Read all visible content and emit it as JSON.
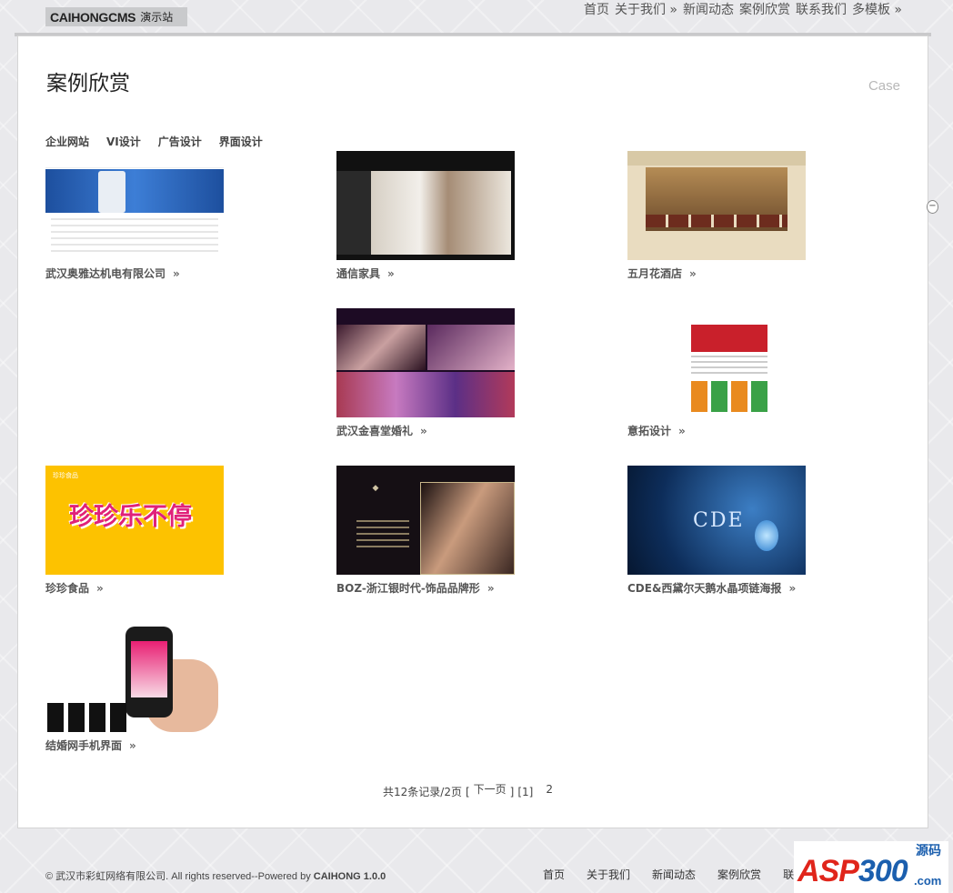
{
  "header": {
    "logo_brand": "CAIHONGCMS",
    "logo_sub": "演示站",
    "nav": [
      "首页",
      "关于我们 »",
      "新闻动态",
      "案例欣赏",
      "联系我们",
      "多模板 »"
    ]
  },
  "page": {
    "title": "案例欣赏",
    "title_en": "Case",
    "categories": [
      "企业网站",
      "VI设计",
      "广告设计",
      "界面设计"
    ]
  },
  "cases": [
    {
      "title": "武汉奥雅达机电有限公司",
      "more": "»"
    },
    {
      "title": "通信家具",
      "more": "»"
    },
    {
      "title": "五月花酒店",
      "more": "»"
    },
    {
      "title": "武汉金喜堂婚礼",
      "more": "»"
    },
    {
      "title": "意拓设计",
      "more": "»"
    },
    {
      "title": "珍珍食品",
      "more": "»"
    },
    {
      "title": "BOZ-浙江银时代-饰品品牌形",
      "more": "»"
    },
    {
      "title": "CDE&西黛尔天鹅水晶项链海报",
      "more": "»"
    },
    {
      "title": "结婚网手机界面",
      "more": "»"
    }
  ],
  "thumbs": {
    "zhenzhen_tag": "珍珍食品",
    "zhenzhen_word": "珍珍乐不停",
    "cde_word": "CDE"
  },
  "pager": {
    "summary": "共12条记录/2页",
    "open_bracket": "[",
    "next": "下一页",
    "close_bracket": "]",
    "page1": "[1]",
    "page2": "2"
  },
  "footer": {
    "copyright": "© 武汉市彩虹网络有限公司. All rights reserved--Powered by",
    "powered_by": "CAIHONG 1.0.0",
    "nav": [
      "首页",
      "关于我们",
      "新闻动态",
      "案例欣赏",
      "联"
    ]
  },
  "badge": {
    "asp": "ASP",
    "num": "300",
    "side": "源码",
    "com": ".com"
  }
}
